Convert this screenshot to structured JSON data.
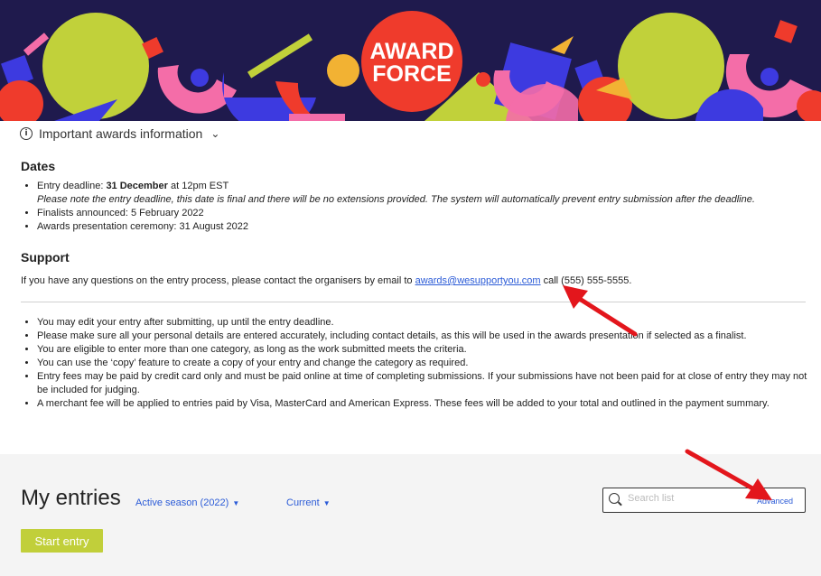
{
  "banner": {
    "logo_line1": "AWARD",
    "logo_line2": "FORCE"
  },
  "info_toggle": {
    "label": "Important awards information",
    "icon": "info-icon",
    "chevron": "chevron-down-icon"
  },
  "dates": {
    "heading": "Dates",
    "entry_deadline_prefix": "Entry deadline: ",
    "entry_deadline_bold": "31 December",
    "entry_deadline_suffix": " at 12pm EST",
    "entry_deadline_note": "Please note the entry deadline, this date is final and there will be no extensions provided. The system will automatically prevent entry submission after the deadline.",
    "finalists": "Finalists announced: 5 February 2022",
    "ceremony": "Awards presentation ceremony: 31 August 2022"
  },
  "support": {
    "heading": "Support",
    "text_prefix": "If you have any questions on the entry process, please contact the organisers by email to ",
    "email": "awards@wesupportyou.com",
    "text_suffix": " call (555) 555-5555."
  },
  "rules": [
    "You may edit your entry after submitting, up until the entry deadline.",
    "Please make sure all your personal details are entered accurately, including contact details, as this will be used in the awards presentation if selected as a finalist.",
    "You are eligible to enter more than one category, as long as the work submitted meets the criteria.",
    "You can use the ‘copy’ feature to create a copy of your entry and change the category as required.",
    "Entry fees may be paid by credit card only and must be paid online at time of completing submissions. If your submissions have not been paid for at close of entry they may not be included for judging.",
    "A merchant fee will be applied to entries paid by Visa, MasterCard and American Express. These fees will be added to your total and outlined in the payment summary."
  ],
  "entries": {
    "title": "My entries",
    "season_filter": "Active season (2022)",
    "status_filter": "Current",
    "search_placeholder": "Search list",
    "advanced_link": "Advanced",
    "start_button": "Start entry"
  },
  "colors": {
    "accent_link": "#2b5bd7",
    "start_button": "#c1cf3a",
    "banner_bg": "#1f1a4d",
    "logo_red": "#ef3b2c",
    "annotation_arrow": "#e3161c"
  }
}
